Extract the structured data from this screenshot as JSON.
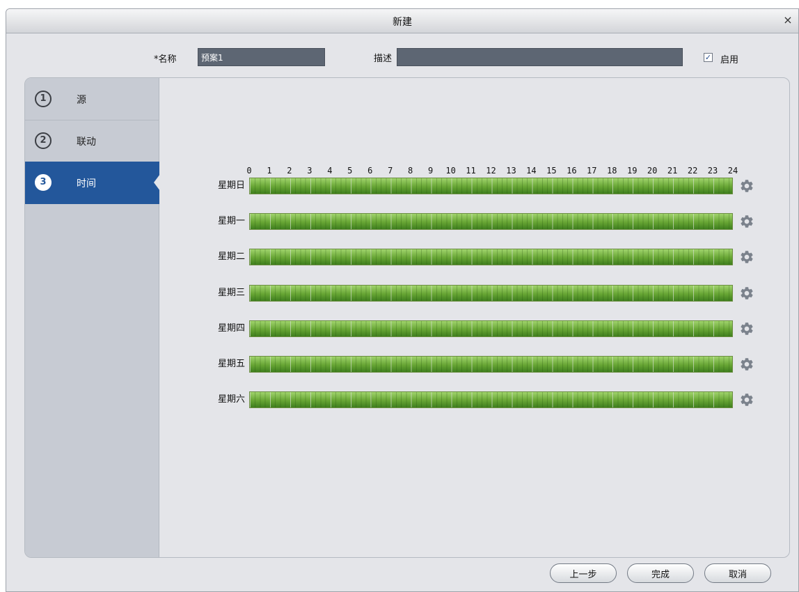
{
  "dialog": {
    "title": "新建",
    "close_glyph": "×",
    "close_icon": "close-icon"
  },
  "form": {
    "name_label": "*名称",
    "name_value": "预案1",
    "desc_label": "描述",
    "desc_value": "",
    "enable_label": "启用",
    "enable_checked": true,
    "check_glyph": "✓"
  },
  "steps": [
    {
      "num": "1",
      "label": "源",
      "active": false
    },
    {
      "num": "2",
      "label": "联动",
      "active": false
    },
    {
      "num": "3",
      "label": "时间",
      "active": true
    }
  ],
  "schedule": {
    "hours": [
      "0",
      "1",
      "2",
      "3",
      "4",
      "5",
      "6",
      "7",
      "8",
      "9",
      "10",
      "11",
      "12",
      "13",
      "14",
      "15",
      "16",
      "17",
      "18",
      "19",
      "20",
      "21",
      "22",
      "23",
      "24"
    ],
    "days": [
      "星期日",
      "星期一",
      "星期二",
      "星期三",
      "星期四",
      "星期五",
      "星期六"
    ],
    "fill_color": "#6fb03a",
    "settings_icon": "gear-icon"
  },
  "buttons": {
    "prev": "上一步",
    "finish": "完成",
    "cancel": "取消"
  }
}
